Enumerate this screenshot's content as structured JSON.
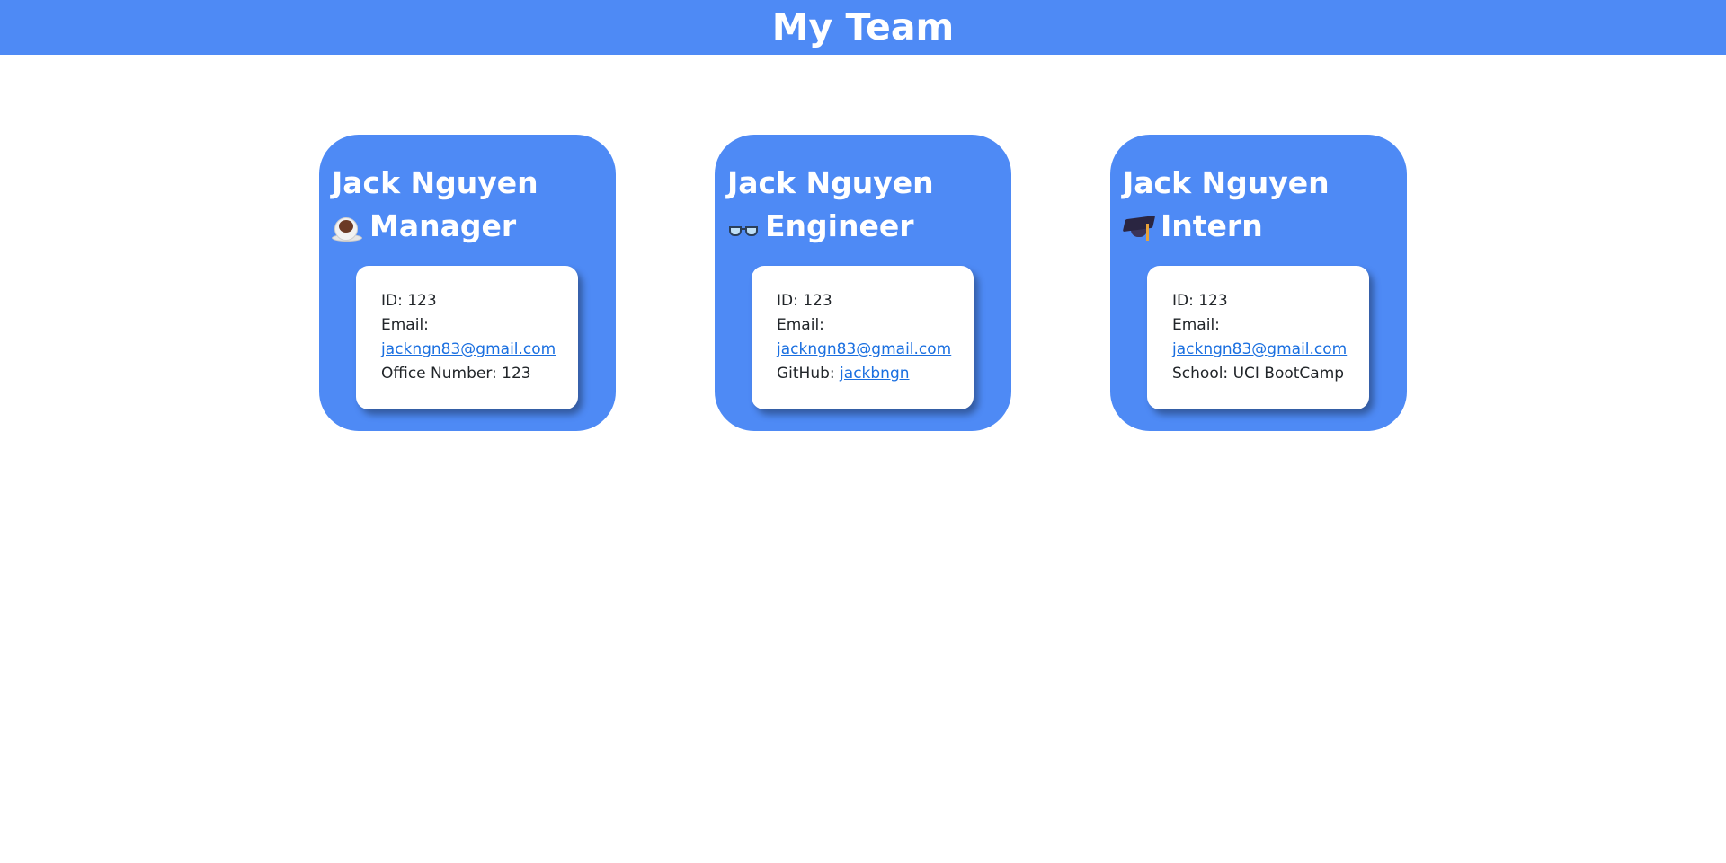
{
  "header": {
    "title": "My Team"
  },
  "theme": {
    "primary": "#4e8af5",
    "link": "#1a6fe0"
  },
  "cards": [
    {
      "name": "Jack Nguyen",
      "role": "Manager",
      "role_icon": "coffee-icon",
      "id_text": "ID: 123",
      "email_label": "Email:",
      "email": "jackngn83@gmail.com",
      "extra_label": "Office Number: 123",
      "extra_link": ""
    },
    {
      "name": "Jack Nguyen",
      "role": "Engineer",
      "role_icon": "glasses-icon",
      "id_text": "ID: 123",
      "email_label": "Email:",
      "email": "jackngn83@gmail.com",
      "extra_label": "GitHub:",
      "extra_link": "jackbngn"
    },
    {
      "name": "Jack Nguyen",
      "role": "Intern",
      "role_icon": "graduation-cap-icon",
      "id_text": "ID: 123",
      "email_label": "Email:",
      "email": "jackngn83@gmail.com",
      "extra_label": "School: UCI BootCamp",
      "extra_link": ""
    }
  ]
}
